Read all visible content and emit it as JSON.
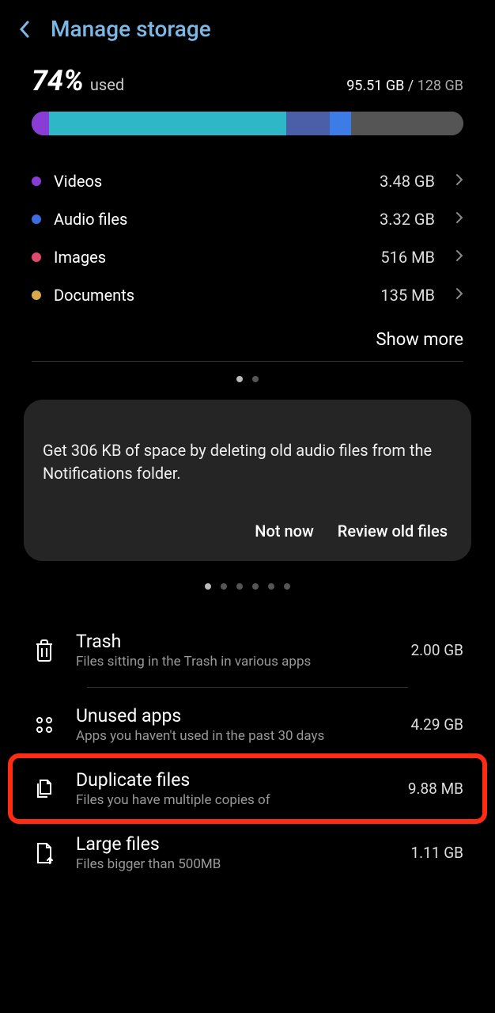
{
  "header": {
    "title": "Manage storage"
  },
  "usage": {
    "percent": "74%",
    "used_word": "used",
    "used_size": "95.51 GB",
    "separator": " / ",
    "total_size": "128 GB"
  },
  "bar_segments": [
    {
      "color": "#8a3cd6",
      "pct": 4
    },
    {
      "color": "#2db7c7",
      "pct": 55
    },
    {
      "color": "#4b5ea8",
      "pct": 10
    },
    {
      "color": "#3d7be6",
      "pct": 5
    },
    {
      "color": "#555555",
      "pct": 26
    }
  ],
  "categories": [
    {
      "name": "Videos",
      "size": "3.48 GB",
      "color": "#8a3cd6"
    },
    {
      "name": "Audio files",
      "size": "3.32 GB",
      "color": "#3d6be0"
    },
    {
      "name": "Images",
      "size": "516 MB",
      "color": "#e04a6b"
    },
    {
      "name": "Documents",
      "size": "135 MB",
      "color": "#d9a84b"
    }
  ],
  "show_more": "Show more",
  "card": {
    "text": "Get 306 KB of space by deleting old audio files from the Notifications folder.",
    "not_now": "Not now",
    "review": "Review old files"
  },
  "cleanup": [
    {
      "title": "Trash",
      "desc": "Files sitting in the Trash in various apps",
      "size": "2.00 GB",
      "icon": "trash",
      "hl": false
    },
    {
      "title": "Unused apps",
      "desc": "Apps you haven't used in the past 30 days",
      "size": "4.29 GB",
      "icon": "apps",
      "hl": false
    },
    {
      "title": "Duplicate files",
      "desc": "Files you have multiple copies of",
      "size": "9.88 MB",
      "icon": "duplicate",
      "hl": true
    },
    {
      "title": "Large files",
      "desc": "Files bigger than 500MB",
      "size": "1.11 GB",
      "icon": "largefile",
      "hl": false
    }
  ]
}
